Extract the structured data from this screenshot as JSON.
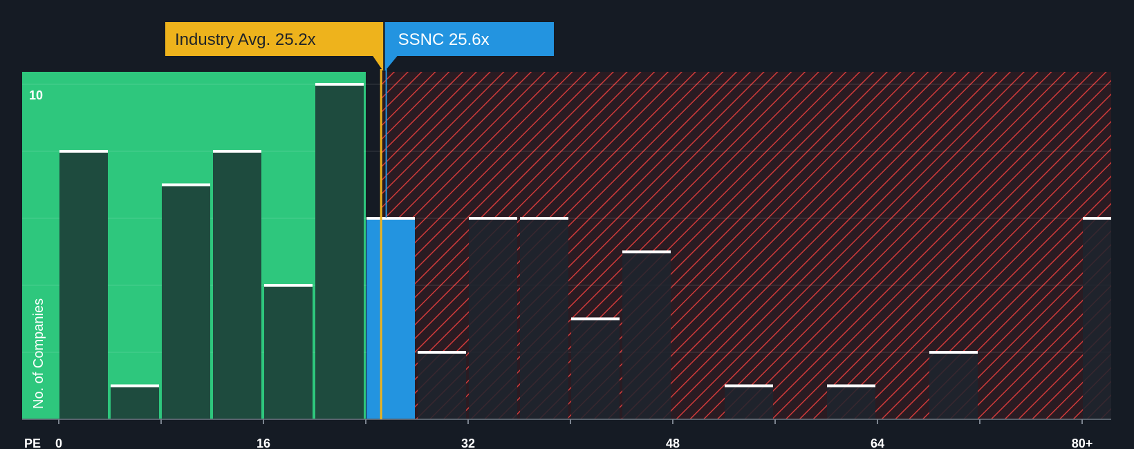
{
  "chart_data": {
    "type": "bar",
    "xlabel": "PE",
    "ylabel": "No. of Companies",
    "x_ticks": [
      "0",
      "16",
      "32",
      "48",
      "64",
      "80+"
    ],
    "x_tick_values": [
      0,
      16,
      32,
      48,
      64,
      80
    ],
    "y_ticks": [
      "10"
    ],
    "y_tick_values": [
      10
    ],
    "xlim": [
      0,
      82
    ],
    "ylim": [
      0,
      10
    ],
    "bin_width": 4,
    "bins": [
      {
        "x": 0,
        "value": 8
      },
      {
        "x": 4,
        "value": 1
      },
      {
        "x": 8,
        "value": 7
      },
      {
        "x": 12,
        "value": 8
      },
      {
        "x": 16,
        "value": 4
      },
      {
        "x": 20,
        "value": 10
      },
      {
        "x": 24,
        "value": 6
      },
      {
        "x": 28,
        "value": 2
      },
      {
        "x": 32,
        "value": 6
      },
      {
        "x": 36,
        "value": 6
      },
      {
        "x": 40,
        "value": 3
      },
      {
        "x": 44,
        "value": 5
      },
      {
        "x": 48,
        "value": 0
      },
      {
        "x": 52,
        "value": 1
      },
      {
        "x": 56,
        "value": 0
      },
      {
        "x": 60,
        "value": 1
      },
      {
        "x": 64,
        "value": 0
      },
      {
        "x": 68,
        "value": 2
      },
      {
        "x": 72,
        "value": 0
      },
      {
        "x": 76,
        "value": 0
      },
      {
        "x": 80,
        "value": 6
      }
    ],
    "highlight_bin_x": 24,
    "industry_avg": {
      "label": "Industry Avg. 25.2x",
      "value": 25.2
    },
    "company": {
      "label": "SSNC 25.6x",
      "value": 25.6
    },
    "grid": true,
    "colors": {
      "background": "#151b24",
      "fair_zone": "#2ec77d",
      "bar_fair": "#1e4b3e",
      "bar_over": "#1d242e",
      "bar_cap": "#ffffff",
      "highlight": "#2394e0",
      "hatch": "#d03a3a",
      "overvalued_bg": "#2a1b22",
      "industry": "#eeb31c",
      "industry_text": "#1f2328",
      "company_text": "#ffffff"
    }
  }
}
